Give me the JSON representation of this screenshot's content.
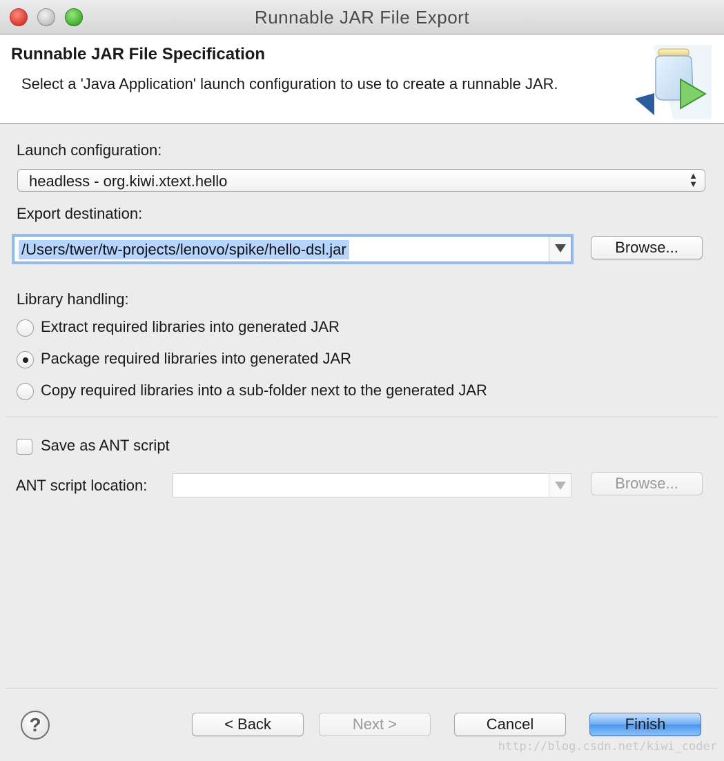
{
  "window": {
    "title": "Runnable JAR File Export"
  },
  "banner": {
    "title": "Runnable JAR File Specification",
    "description": "Select a 'Java Application' launch configuration to use to create a runnable JAR."
  },
  "launch": {
    "label": "Launch configuration:",
    "value": "headless - org.kiwi.xtext.hello"
  },
  "export": {
    "label": "Export destination:",
    "value": "/Users/twer/tw-projects/lenovo/spike/hello-dsl.jar",
    "browse_label": "Browse..."
  },
  "library": {
    "label": "Library handling:",
    "options": [
      {
        "label": "Extract required libraries into generated JAR",
        "selected": false
      },
      {
        "label": "Package required libraries into generated JAR",
        "selected": true
      },
      {
        "label": "Copy required libraries into a sub-folder next to the generated JAR",
        "selected": false
      }
    ]
  },
  "ant": {
    "save_label": "Save as ANT script",
    "save_checked": false,
    "location_label": "ANT script location:",
    "location_value": "",
    "browse_label": "Browse..."
  },
  "footer": {
    "help_symbol": "?",
    "back_label": "< Back",
    "next_label": "Next >",
    "cancel_label": "Cancel",
    "finish_label": "Finish"
  },
  "watermark": "http://blog.csdn.net/kiwi_coder",
  "colors": {
    "selection": "#b5d5ff",
    "focus_ring": "#93bbf0",
    "default_button": "#4d97ef"
  }
}
